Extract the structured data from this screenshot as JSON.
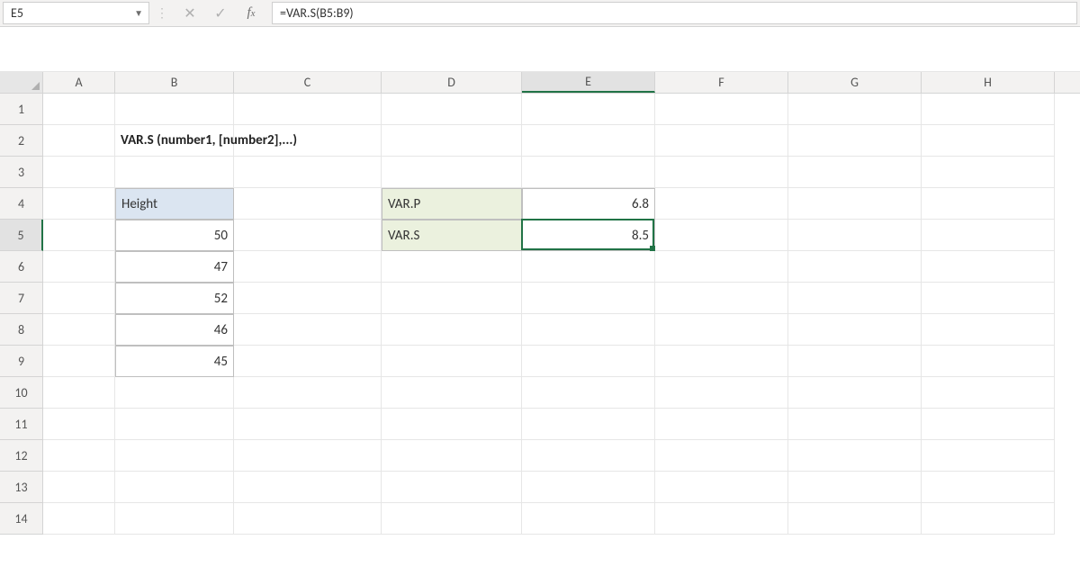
{
  "name_box": "E5",
  "formula": "=VAR.S(B5:B9)",
  "columns": [
    "A",
    "B",
    "C",
    "D",
    "E",
    "F",
    "G",
    "H"
  ],
  "row_count": 14,
  "title_text": "VAR.S (number1, [number2],...)",
  "height_table": {
    "header": "Height",
    "values": [
      "50",
      "47",
      "52",
      "46",
      "45"
    ]
  },
  "results": [
    {
      "label": "VAR.P",
      "value": "6.8"
    },
    {
      "label": "VAR.S",
      "value": "8.5"
    }
  ],
  "selected": {
    "col": "E",
    "row": 5
  }
}
